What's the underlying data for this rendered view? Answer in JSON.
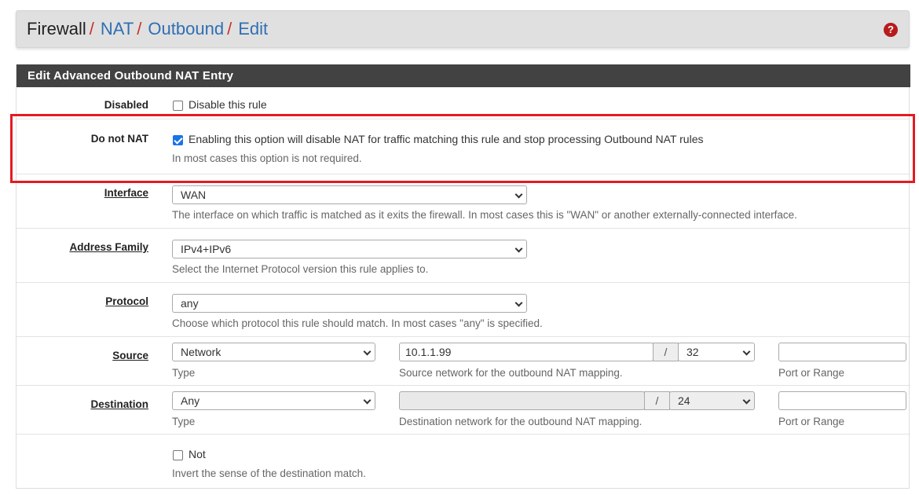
{
  "breadcrumb": {
    "root": "Firewall",
    "items": [
      "NAT",
      "Outbound",
      "Edit"
    ],
    "separator": "/",
    "help_icon": "question-circle-icon"
  },
  "panel": {
    "title": "Edit Advanced Outbound NAT Entry"
  },
  "disabled": {
    "label": "Disabled",
    "checkbox_label": "Disable this rule",
    "checked": false
  },
  "nonat": {
    "label": "Do not NAT",
    "checkbox_label": "Enabling this option will disable NAT for traffic matching this rule and stop processing Outbound NAT rules",
    "help": "In most cases this option is not required.",
    "checked": true
  },
  "interface": {
    "label": "Interface",
    "value": "WAN",
    "help": "The interface on which traffic is matched as it exits the firewall. In most cases this is \"WAN\" or another externally-connected interface."
  },
  "address_family": {
    "label": "Address Family",
    "value": "IPv4+IPv6",
    "help": "Select the Internet Protocol version this rule applies to."
  },
  "protocol": {
    "label": "Protocol",
    "value": "any",
    "help": "Choose which protocol this rule should match. In most cases \"any\" is specified."
  },
  "source": {
    "label": "Source",
    "type": "Network",
    "type_help": "Type",
    "address": "10.1.1.99",
    "slash": "/",
    "mask": "32",
    "address_help": "Source network for the outbound NAT mapping.",
    "port": "",
    "port_help": "Port or Range"
  },
  "destination": {
    "label": "Destination",
    "type": "Any",
    "type_help": "Type",
    "address": "",
    "slash": "/",
    "mask": "24",
    "address_help": "Destination network for the outbound NAT mapping.",
    "port": "",
    "port_help": "Port or Range"
  },
  "not": {
    "checkbox_label": "Not",
    "help": "Invert the sense of the destination match.",
    "checked": false
  },
  "colors": {
    "highlight": "#e21b23",
    "link": "#2f6fb3",
    "heading_bg": "#424242",
    "checkbox_accent": "#1a73e8"
  }
}
